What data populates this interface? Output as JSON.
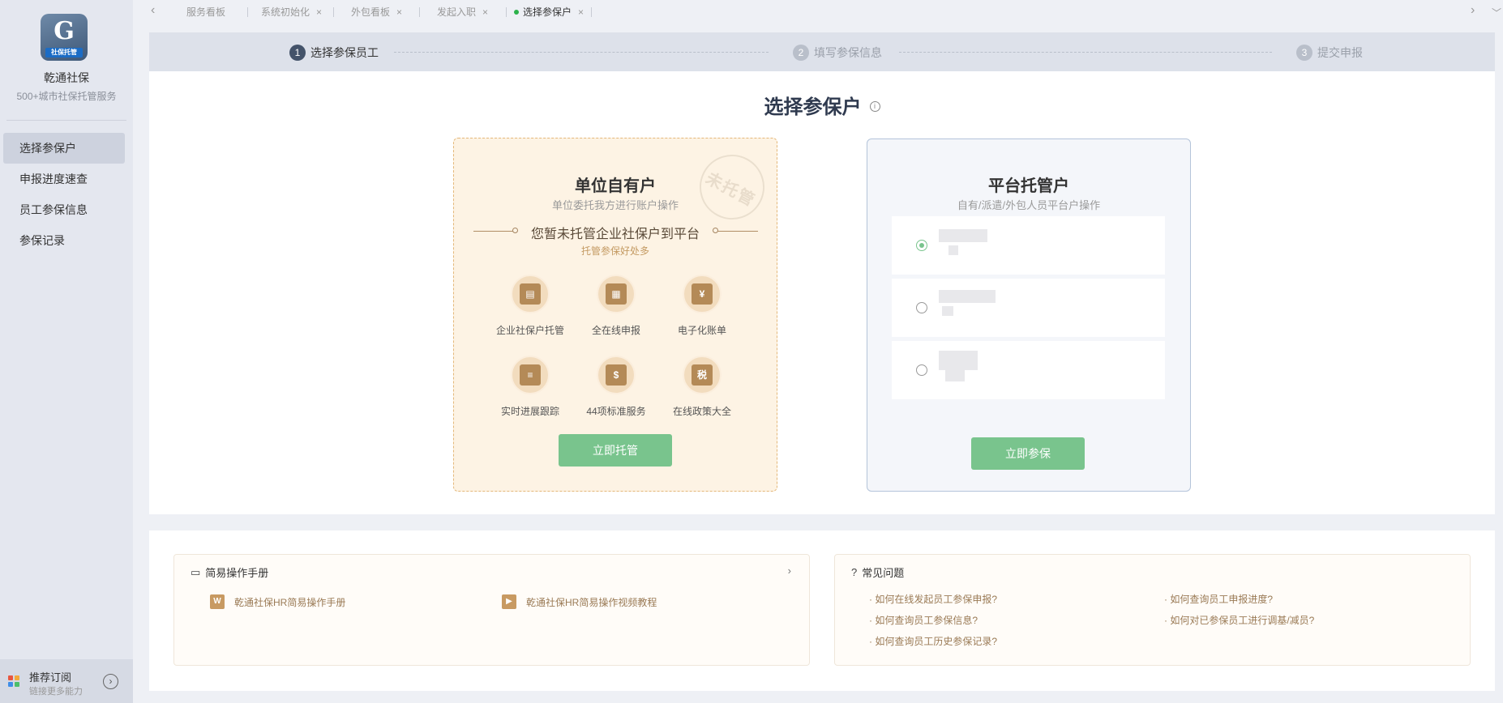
{
  "app": {
    "name": "乾通社保",
    "subtitle": "500+城市社保托管服务",
    "logo_text": "社保托管",
    "logo_letter": "G"
  },
  "sidebar": {
    "items": [
      {
        "label": "选择参保户",
        "active": true
      },
      {
        "label": "申报进度速查",
        "active": false
      },
      {
        "label": "员工参保信息",
        "active": false
      },
      {
        "label": "参保记录",
        "active": false
      }
    ],
    "bottom": {
      "title": "推荐订阅",
      "subtitle": "链接更多能力"
    }
  },
  "tabs": {
    "items": [
      {
        "label": "服务看板"
      },
      {
        "label": "系统初始化"
      },
      {
        "label": "外包看板"
      },
      {
        "label": "发起入职"
      },
      {
        "label": "选择参保户",
        "active": true
      }
    ],
    "active_dot_color": "#2cb24a"
  },
  "steps": [
    {
      "num": "1",
      "label": "选择参保员工",
      "active": true
    },
    {
      "num": "2",
      "label": "填写参保信息",
      "active": false
    },
    {
      "num": "3",
      "label": "提交申报",
      "active": false
    }
  ],
  "main": {
    "title": "选择参保户",
    "own_card": {
      "title": "单位自有户",
      "subtitle": "单位委托我方进行账户操作",
      "stamp": "未托管",
      "headline": "您暂未托管企业社保户到平台",
      "headline_sub": "托管参保好处多",
      "features": [
        {
          "label": "企业社保户托管",
          "icon": "id-card-icon",
          "glyph": "▤"
        },
        {
          "label": "全在线申报",
          "icon": "calculator-icon",
          "glyph": "▦"
        },
        {
          "label": "电子化账单",
          "icon": "receipt-icon",
          "glyph": "¥"
        },
        {
          "label": "实时进展跟踪",
          "icon": "document-icon",
          "glyph": "≡"
        },
        {
          "label": "44项标准服务",
          "icon": "list-icon",
          "glyph": "$"
        },
        {
          "label": "在线政策大全",
          "icon": "tax-icon",
          "glyph": "税"
        }
      ],
      "button": "立即托管"
    },
    "platform_card": {
      "title": "平台托管户",
      "subtitle": "自有/派遣/外包人员平台户操作",
      "options": [
        {
          "selected": true
        },
        {
          "selected": false
        },
        {
          "selected": false
        }
      ],
      "button": "立即参保"
    }
  },
  "manual": {
    "title": "简易操作手册",
    "docs": [
      {
        "label": "乾通社保HR简易操作手册",
        "icon": "word-doc-icon"
      },
      {
        "label": "乾通社保HR简易操作视频教程",
        "icon": "video-icon"
      }
    ]
  },
  "faq": {
    "title": "常见问题",
    "items": [
      "· 如何在线发起员工参保申报?",
      "· 如何查询员工申报进度?",
      "· 如何查询员工参保信息?",
      "· 如何对已参保员工进行调基/减员?",
      "· 如何查询员工历史参保记录?"
    ]
  },
  "colors": {
    "accent_green": "#79c48d",
    "sidebar_bg": "#e4e7ef",
    "own_card_bg": "#fdf3e4",
    "step_active": "#44536a"
  }
}
